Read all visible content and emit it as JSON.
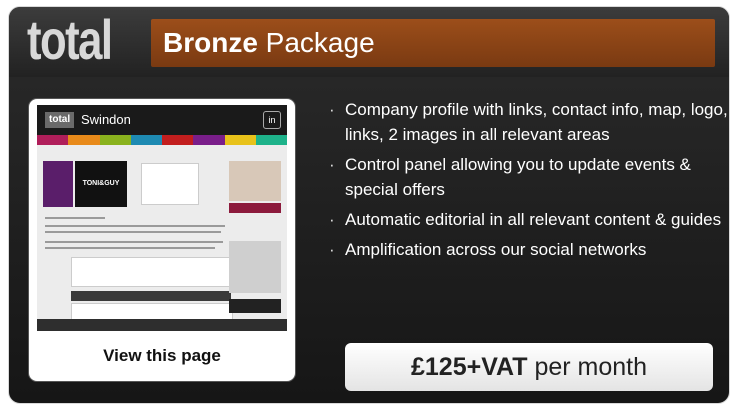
{
  "header": {
    "logo_text": "total",
    "title_bold": "Bronze",
    "title_rest": " Package"
  },
  "thumbnail": {
    "site_logo": "total",
    "site_city": "Swindon",
    "badge": "in",
    "brand_text": "TONI&GUY",
    "view_label": "View this page"
  },
  "features": [
    "Company profile with links, contact info, map, logo, links, 2 images in all relevant areas",
    "Control panel allowing you to update events & special offers",
    "Automatic editorial in all relevant content & guides",
    "Amplification across our social networks"
  ],
  "price": {
    "amount": "£125+VAT",
    "period": " per month"
  },
  "colors": {
    "accent": "#8a4417",
    "panel": "#1f1f1f",
    "button": "#f2f2f2"
  }
}
